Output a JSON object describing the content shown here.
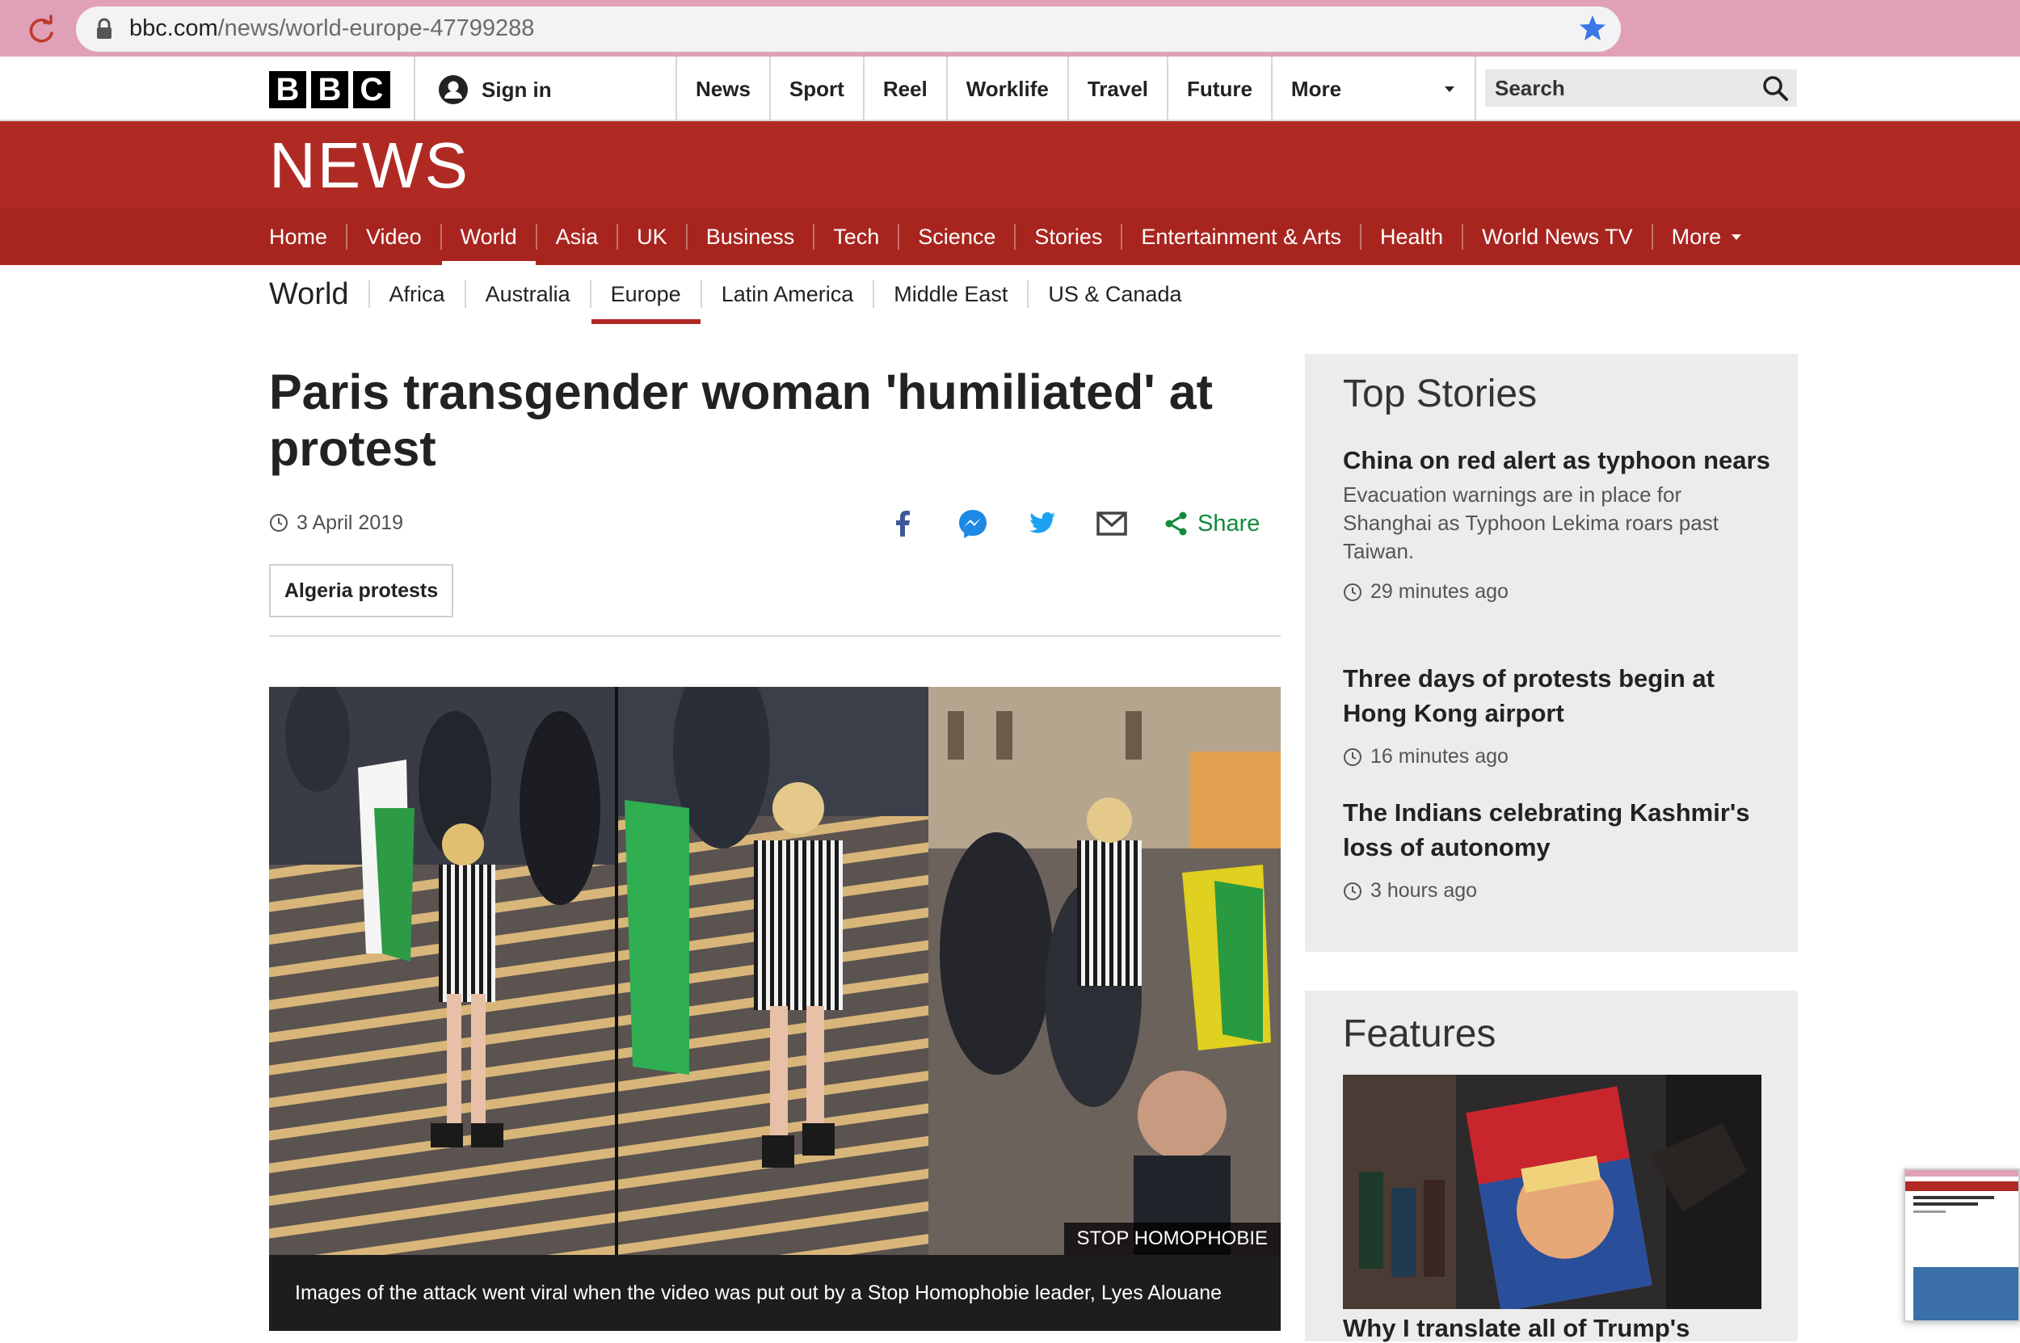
{
  "browser": {
    "url_domain": "bbc.com",
    "url_path": "/news/world-europe-47799288"
  },
  "topbar": {
    "logo_letters": [
      "B",
      "B",
      "C"
    ],
    "sign_in": "Sign in",
    "nav": [
      "News",
      "Sport",
      "Reel",
      "Worklife",
      "Travel",
      "Future"
    ],
    "more": "More",
    "search_label": "Search"
  },
  "news": {
    "logo": "NEWS",
    "nav": [
      "Home",
      "Video",
      "World",
      "Asia",
      "UK",
      "Business",
      "Tech",
      "Science",
      "Stories",
      "Entertainment & Arts",
      "Health",
      "World News TV"
    ],
    "active": "World",
    "more": "More"
  },
  "subnav": {
    "title": "World",
    "items": [
      "Africa",
      "Australia",
      "Europe",
      "Latin America",
      "Middle East",
      "US & Canada"
    ],
    "active": "Europe"
  },
  "article": {
    "headline": "Paris transgender woman 'humiliated' at protest",
    "date": "3 April 2019",
    "share_label": "Share",
    "tag": "Algeria protests",
    "image_credit": "STOP HOMOPHOBIE",
    "caption": "Images of the attack went viral when the video was put out by a Stop Homophobie leader, Lyes Alouane"
  },
  "top_stories": {
    "title": "Top Stories",
    "stories": [
      {
        "title": "China on red alert as typhoon nears",
        "summary": "Evacuation warnings are in place for Shanghai as Typhoon Lekima roars past Taiwan.",
        "time": "29 minutes ago"
      },
      {
        "title": "Three days of protests begin at Hong Kong airport",
        "summary": "",
        "time": "16 minutes ago"
      },
      {
        "title": "The Indians celebrating Kashmir's loss of autonomy",
        "summary": "",
        "time": "3 hours ago"
      }
    ]
  },
  "features": {
    "title": "Features",
    "story_title": "Why I translate all of Trump's"
  },
  "colors": {
    "bbc_red": "#b02a24",
    "share_green": "#118a3c",
    "browser_pink": "#dfa0b8"
  }
}
